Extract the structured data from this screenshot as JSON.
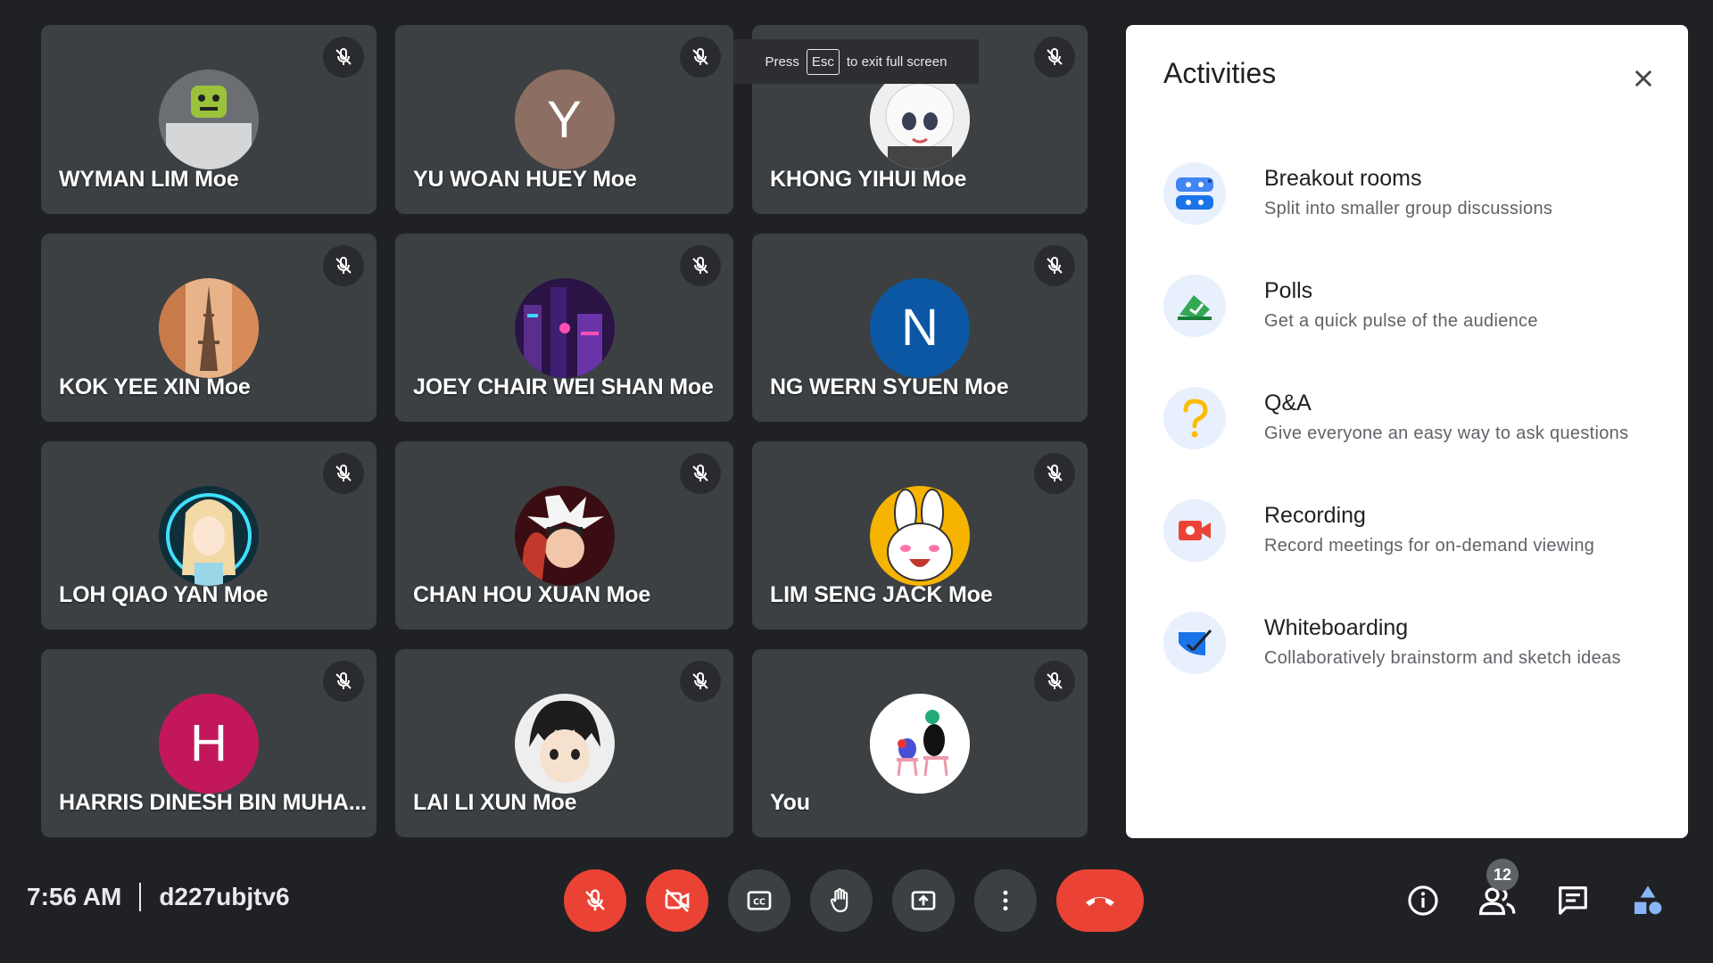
{
  "participants": [
    {
      "name": "WYMAN LIM Moe",
      "avatar": "roblox-character",
      "muted": true
    },
    {
      "name": "YU WOAN HUEY Moe",
      "avatar_letter": "Y",
      "avatar_color": "#8d6e63",
      "muted": true
    },
    {
      "name": "KHONG YIHUI Moe",
      "avatar": "anime-character-white-hair",
      "muted": true
    },
    {
      "name": "KOK YEE XIN Moe",
      "avatar": "eiffel-tower-photo",
      "muted": true
    },
    {
      "name": "JOEY CHAIR WEI SHAN Moe",
      "avatar": "neon-city-photo",
      "muted": true
    },
    {
      "name": "NG WERN SYUEN Moe",
      "avatar_letter": "N",
      "avatar_color": "#0b57a4",
      "muted": true
    },
    {
      "name": "LOH QIAO YAN Moe",
      "avatar": "anime-girl-blonde",
      "muted": true
    },
    {
      "name": "CHAN HOU XUAN Moe",
      "avatar": "anime-characters",
      "muted": true
    },
    {
      "name": "LIM SENG JACK Moe",
      "avatar": "cartoon-rabbit",
      "muted": true
    },
    {
      "name": "HARRIS DINESH BIN MUHA...",
      "avatar_letter": "H",
      "avatar_color": "#c2185b",
      "muted": true
    },
    {
      "name": "LAI LI XUN Moe",
      "avatar": "anime-boy",
      "muted": true
    },
    {
      "name": "You",
      "avatar": "birds-illustration",
      "muted": true
    }
  ],
  "toast": {
    "press": "Press",
    "key": "Esc",
    "suffix": "to exit full screen"
  },
  "panel": {
    "title": "Activities",
    "items": [
      {
        "title": "Breakout rooms",
        "desc": "Split into smaller group discussions",
        "icon": "breakout-rooms-icon"
      },
      {
        "title": "Polls",
        "desc": "Get a quick pulse of the audience",
        "icon": "polls-icon"
      },
      {
        "title": "Q&A",
        "desc": "Give everyone an easy way to ask questions",
        "icon": "qa-icon"
      },
      {
        "title": "Recording",
        "desc": "Record meetings for on-demand viewing",
        "icon": "recording-icon"
      },
      {
        "title": "Whiteboarding",
        "desc": "Collaboratively brainstorm and sketch ideas",
        "icon": "whiteboard-icon"
      }
    ]
  },
  "bottom": {
    "time": "7:56 AM",
    "meeting_code": "d227ubjtv6",
    "participant_count": "12"
  },
  "colors": {
    "background": "#202124",
    "tile": "#3c4043",
    "danger": "#ea4335",
    "panel": "#ffffff"
  }
}
